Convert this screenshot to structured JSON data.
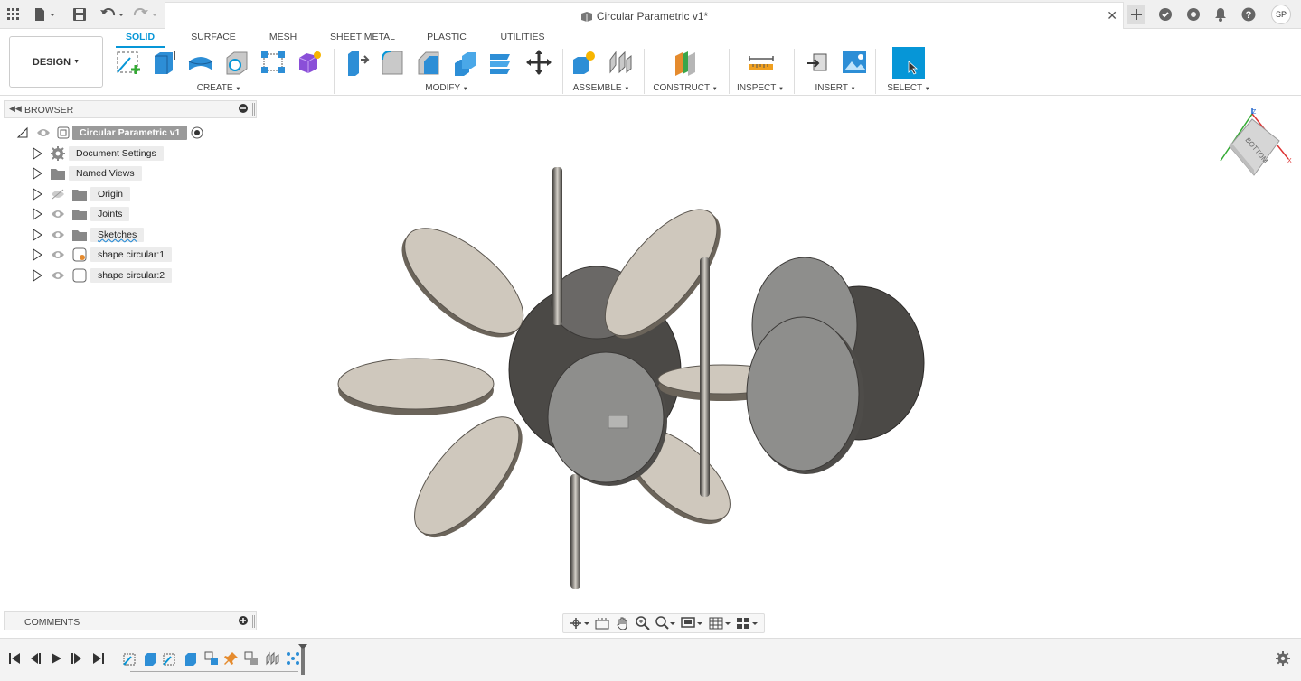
{
  "topbar": {
    "doc_title": "Circular Parametric v1*",
    "avatar_initials": "SP",
    "close_glyph": "✕"
  },
  "ribbon": {
    "workspace": "DESIGN",
    "tabs": [
      "SOLID",
      "SURFACE",
      "MESH",
      "SHEET METAL",
      "PLASTIC",
      "UTILITIES"
    ],
    "active_tab": "SOLID",
    "groups": [
      "CREATE",
      "MODIFY",
      "ASSEMBLE",
      "CONSTRUCT",
      "INSPECT",
      "INSERT",
      "SELECT"
    ]
  },
  "browser": {
    "title": "BROWSER",
    "root": "Circular Parametric v1",
    "items": [
      {
        "label": "Document Settings",
        "icon": "gear-icon"
      },
      {
        "label": "Named Views",
        "icon": "folder-icon"
      },
      {
        "label": "Origin",
        "icon": "folder-icon"
      },
      {
        "label": "Joints",
        "icon": "folder-icon"
      },
      {
        "label": "Sketches",
        "icon": "folder-icon"
      },
      {
        "label": "shape circular:1",
        "icon": "component-icon"
      },
      {
        "label": "shape circular:2",
        "icon": "component-icon"
      }
    ]
  },
  "comments": {
    "title": "COMMENTS"
  },
  "viewcube": {
    "face_label": "BOTTOM"
  },
  "colors": {
    "accent": "#0696d7",
    "select_button": "#0696d7",
    "disc_light": "#cfc8bd",
    "disc_dark": "#4b4946",
    "disc_mid": "#8e8e8c"
  }
}
